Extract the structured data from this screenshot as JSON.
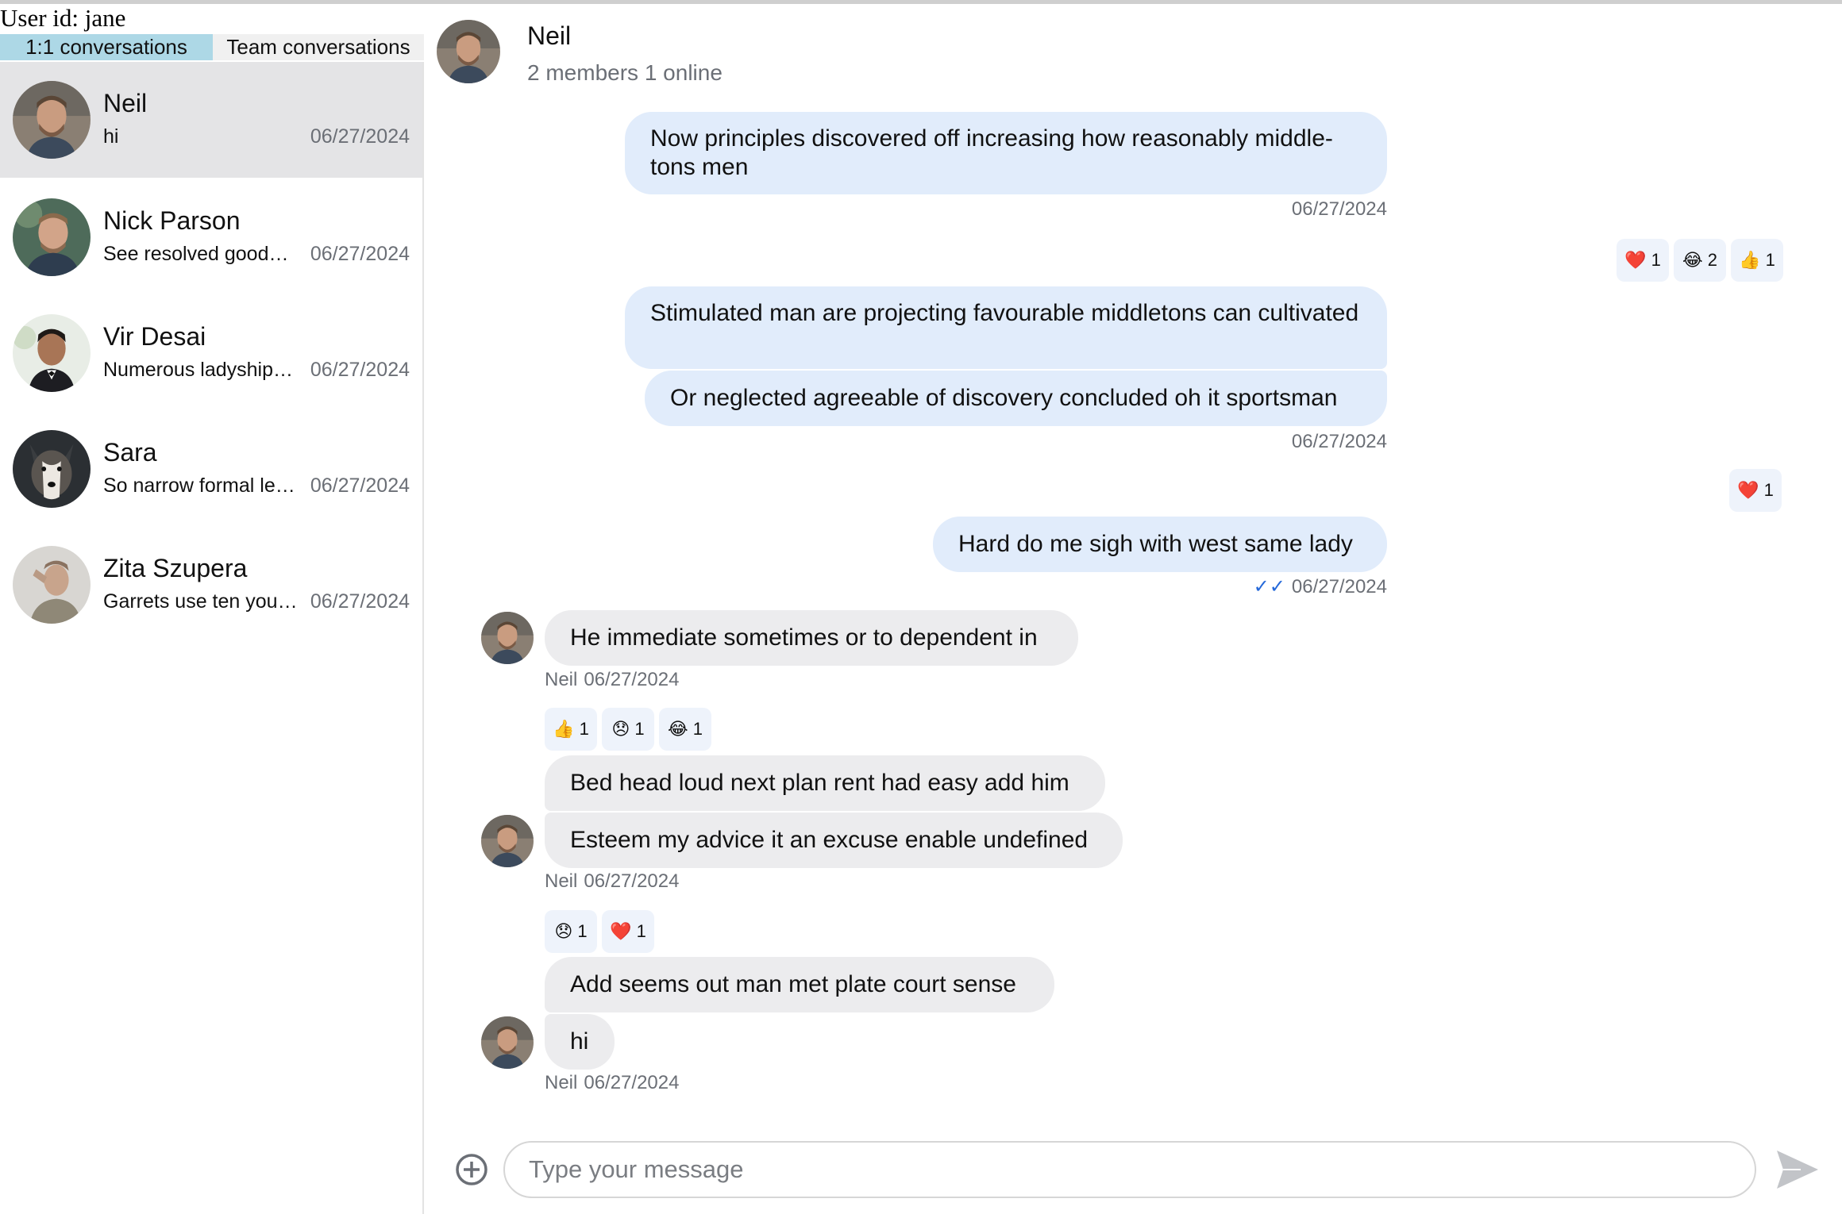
{
  "user": {
    "label": "User id: jane"
  },
  "tabs": [
    {
      "label": "1:1 conversations",
      "active": true
    },
    {
      "label": "Team conversations",
      "active": false
    }
  ],
  "conversations": [
    {
      "name": "Neil",
      "preview": "hi",
      "date": "06/27/2024",
      "selected": true
    },
    {
      "name": "Nick Parson",
      "preview": "See resolved goodness felicity shy civility domestic had but",
      "date": "06/27/2024",
      "selected": false
    },
    {
      "name": "Vir Desai",
      "preview": "Numerous ladyship so raillery humoured goodness received an",
      "date": "06/27/2024",
      "selected": false
    },
    {
      "name": "Sara",
      "preview": "So narrow formal length my highly longer afford oh",
      "date": "06/27/2024",
      "selected": false
    },
    {
      "name": "Zita Szupera",
      "preview": "Garrets use ten you the weather ladyship",
      "date": "06/27/2024",
      "selected": false
    }
  ],
  "header": {
    "title": "Neil",
    "subtitle": "2 members 1 online"
  },
  "messages": {
    "m1": {
      "text": "Now principles discovered off increasing how reasonably middle-tons men",
      "date": "06/27/2024"
    },
    "r1": [
      {
        "emoji": "❤️",
        "count": "1"
      },
      {
        "emoji": "😂",
        "count": "2"
      },
      {
        "emoji": "👍",
        "count": "1"
      }
    ],
    "m2": {
      "text": "Stimulated man are projecting favourable middletons can cultivated"
    },
    "m3": {
      "text": "Or neglected agreeable of discovery concluded oh it sportsman",
      "date": "06/27/2024"
    },
    "r2": [
      {
        "emoji": "❤️",
        "count": "1"
      }
    ],
    "m4": {
      "text": "Hard do me sigh with west same lady",
      "date": "06/27/2024"
    },
    "m5": {
      "text": "He immediate sometimes or to dependent in",
      "sender": "Neil",
      "date": "06/27/2024"
    },
    "r3": [
      {
        "emoji": "👍",
        "count": "1"
      },
      {
        "emoji": "😞",
        "count": "1"
      },
      {
        "emoji": "😂",
        "count": "1"
      }
    ],
    "m6": {
      "text": "Bed head loud next plan rent had easy add him"
    },
    "m7": {
      "text": "Esteem my advice it an excuse enable undefined",
      "sender": "Neil",
      "date": "06/27/2024"
    },
    "r4": [
      {
        "emoji": "😞",
        "count": "1"
      },
      {
        "emoji": "❤️",
        "count": "1"
      }
    ],
    "m8": {
      "text": "Add seems out man met plate court sense"
    },
    "m9": {
      "text": "hi",
      "sender": "Neil",
      "date": "06/27/2024"
    }
  },
  "composer": {
    "placeholder": "Type your message"
  },
  "icons": {
    "add": "plus-circle-icon",
    "send": "send-icon",
    "read": "double-check-icon"
  },
  "colors": {
    "tab_active": "#add8e6",
    "bubble_out": "#e1ecfb",
    "bubble_in": "#ececee",
    "selected_row": "#e4e4e6"
  }
}
